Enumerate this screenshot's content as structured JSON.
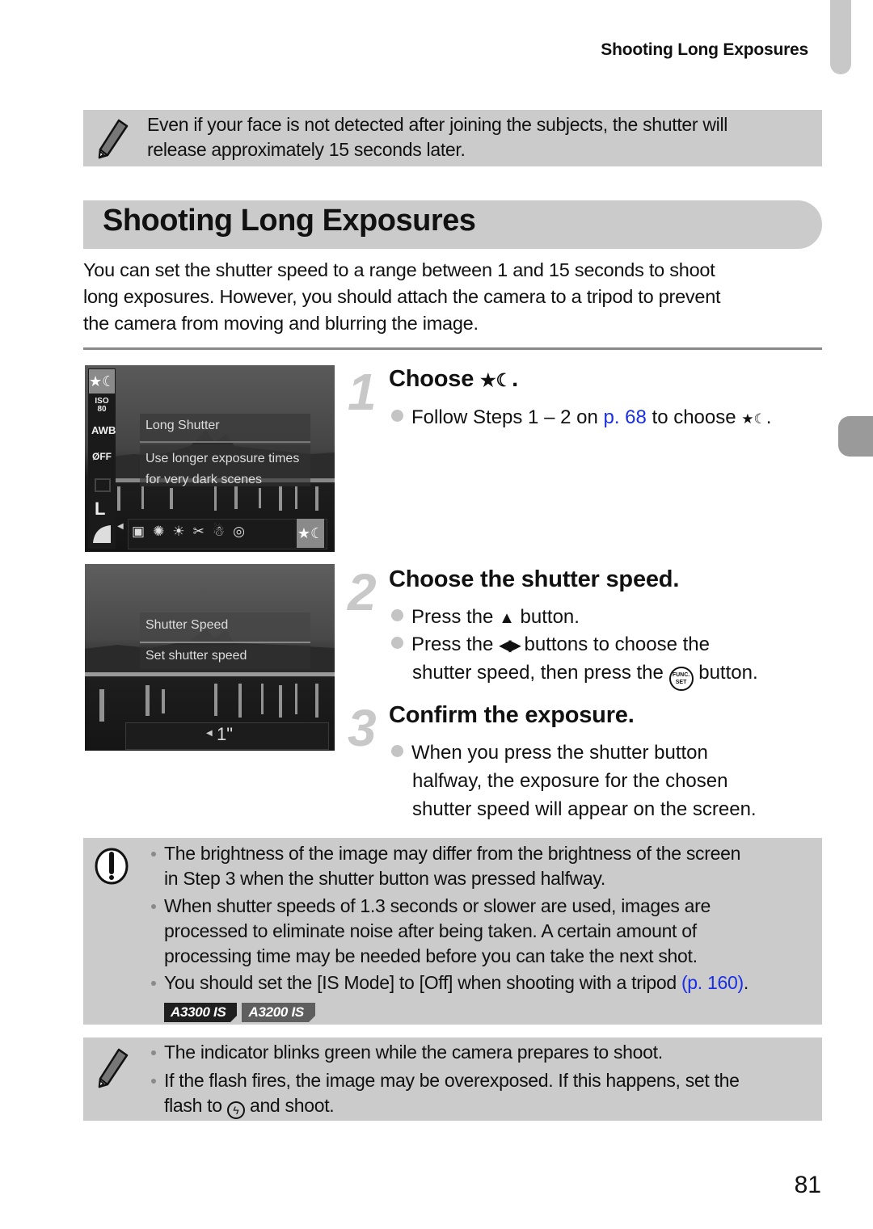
{
  "running_head": "Shooting Long Exposures",
  "top_note": {
    "icon": "pencil-icon",
    "text_line1": "Even if your face is not detected after joining the subjects, the shutter will",
    "text_line2": "release approximately 15 seconds later."
  },
  "section_title": "Shooting Long Exposures",
  "intro": {
    "line1": "You can set the shutter speed to a range between 1 and 15 seconds to shoot",
    "line2": "long exposures. However, you should attach the camera to a tripod to prevent",
    "line3": "the camera from moving and blurring the image."
  },
  "screen1": {
    "menu_title": "Long Shutter",
    "menu_desc_line1": "Use longer exposure times",
    "menu_desc_line2": "for very dark scenes",
    "left_icons": [
      "long-shutter-icon",
      "iso-80-icon",
      "awb-icon",
      "my-colors-off-icon",
      "drive-single-icon",
      "size-large-icon",
      "quality-icon"
    ],
    "iso_label": "ISO",
    "iso_value": "80",
    "awb_label": "AWB",
    "l_label": "L",
    "bottom_icons": [
      "portrait-smart-icon",
      "fireworks-icon",
      "beach-icon",
      "foliage-icon",
      "snow-icon",
      "fisheye-icon",
      "long-shutter-selected-icon"
    ]
  },
  "screen2": {
    "menu_title": "Shutter Speed",
    "menu_desc": "Set shutter speed",
    "value": "1\""
  },
  "steps": [
    {
      "number": "1",
      "title_prefix": "Choose",
      "title_icon": "long-shutter-icon",
      "bullets": [
        {
          "pre": "Follow Steps 1 – 2 on ",
          "link": "p. 68",
          "post": " to choose"
        }
      ]
    },
    {
      "number": "2",
      "title": "Choose the shutter speed.",
      "bullets": [
        {
          "pre": "Press the",
          "icon": "up-arrow-icon",
          "post": "button."
        },
        {
          "pre": "Press the",
          "icon": "left-right-arrows-icon",
          "post": "buttons to choose the"
        },
        {
          "cont": "shutter speed, then press the",
          "icon": "func-set-button-icon",
          "post": "button.",
          "func_top": "FUNC.",
          "func_bottom": "SET"
        }
      ]
    },
    {
      "number": "3",
      "title": "Confirm the exposure.",
      "bullets": [
        {
          "line1": "When you press the shutter button",
          "line2": "halfway, the exposure for the chosen",
          "line3": "shutter speed will appear on the screen."
        }
      ]
    }
  ],
  "caution": {
    "icon": "caution-icon",
    "items": [
      {
        "line1": "The brightness of the image may differ from the brightness of the screen",
        "line2": "in Step 3 when the shutter button was pressed halfway."
      },
      {
        "line1": "When shutter speeds of 1.3 seconds or slower are used, images are",
        "line2": "processed to eliminate noise after being taken. A certain amount of",
        "line3": "processing time may be needed before you can take the next shot."
      },
      {
        "line1_pre": "You should set the [IS Mode] to [Off] when shooting with a tripod ",
        "link": "(p. 160)",
        "line1_post": ".",
        "badges": [
          "A3300 IS",
          "A3200 IS"
        ]
      }
    ]
  },
  "bottom_note": {
    "icon": "pencil-icon",
    "items": [
      {
        "line1": "The indicator blinks green while the camera prepares to shoot."
      },
      {
        "line1": "If the flash fires, the image may be overexposed. If this happens, set the",
        "line2_pre": "flash to",
        "line2_icon": "flash-off-icon",
        "line2_post": "and shoot."
      }
    ]
  },
  "page_number": "81",
  "colors": {
    "link": "#1a2ee6",
    "note_bg": "#cbcbcb",
    "step_number": "#c8c8c8"
  }
}
